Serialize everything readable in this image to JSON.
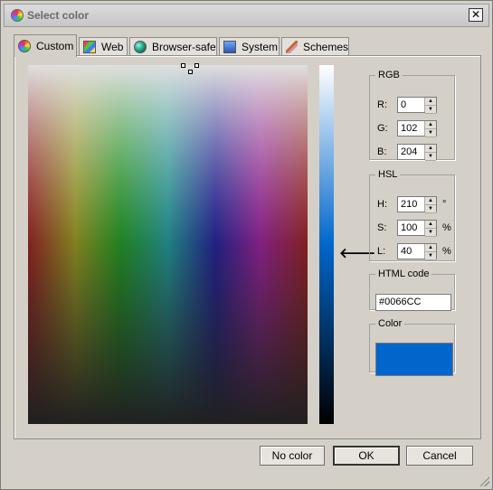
{
  "window": {
    "title": "Select color",
    "close_label": "✕"
  },
  "tabs": [
    {
      "label": "Custom",
      "icon": "color-wheel-icon",
      "active": true
    },
    {
      "label": "Web",
      "icon": "web-palette-icon",
      "active": false
    },
    {
      "label": "Browser-safe",
      "icon": "globe-icon",
      "active": false
    },
    {
      "label": "System",
      "icon": "monitor-icon",
      "active": false
    },
    {
      "label": "Schemes",
      "icon": "brush-icon",
      "active": false
    }
  ],
  "rgb": {
    "legend": "RGB",
    "r_label": "R:",
    "r": "0",
    "g_label": "G:",
    "g": "102",
    "b_label": "B:",
    "b": "204"
  },
  "hsl": {
    "legend": "HSL",
    "h_label": "H:",
    "h": "210",
    "h_unit": "°",
    "s_label": "S:",
    "s": "100",
    "s_unit": "%",
    "l_label": "L:",
    "l": "40",
    "l_unit": "%"
  },
  "html_code": {
    "legend": "HTML code",
    "value": "#0066CC"
  },
  "color": {
    "legend": "Color",
    "swatch": "#0066CC"
  },
  "buttons": {
    "no_color": "No color",
    "ok": "OK",
    "cancel": "Cancel"
  },
  "colors": {
    "window_bg": "#D4D0C8",
    "selected": "#0066CC"
  }
}
